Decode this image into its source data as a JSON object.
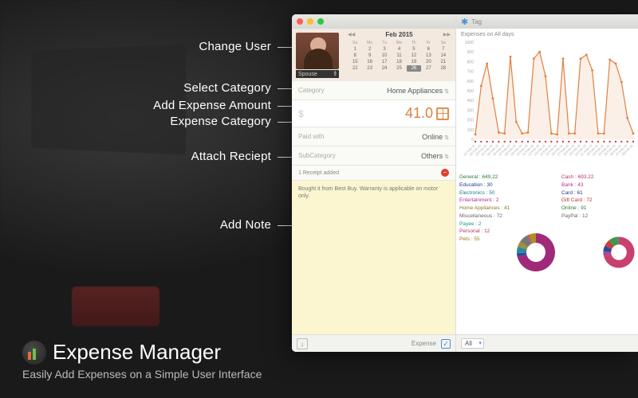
{
  "callouts": {
    "change_user": "Change User",
    "select_category": "Select Category",
    "add_amount": "Add Expense Amount",
    "expense_category": "Expense Category",
    "attach_receipt": "Attach Reciept",
    "add_note": "Add Note"
  },
  "app": {
    "title": "Expense Manager",
    "subtitle": "Easily Add Expenses on a Simple User Interface"
  },
  "user": {
    "name": "Spouse"
  },
  "calendar": {
    "title": "Feb 2015",
    "dow": [
      "Su",
      "Mo",
      "Tu",
      "We",
      "Th",
      "Fr",
      "Sa"
    ],
    "days": [
      "1",
      "2",
      "3",
      "4",
      "5",
      "6",
      "7",
      "8",
      "9",
      "10",
      "11",
      "12",
      "13",
      "14",
      "15",
      "16",
      "17",
      "18",
      "19",
      "20",
      "21",
      "22",
      "23",
      "24",
      "25",
      "26",
      "27",
      "28"
    ],
    "selected": "26"
  },
  "form": {
    "category_label": "Category",
    "category_value": "Home Appliances",
    "currency": "$",
    "amount": "41.0",
    "paid_label": "Paid with",
    "paid_value": "Online",
    "subcat_label": "SubCategory",
    "subcat_value": "Others",
    "receipt_text": "1 Receipt added",
    "note_text": "Bought it from Best Buy. Warranty is applicable on motor only.",
    "expense_label": "Expense"
  },
  "tag_label": "Tag",
  "chart_title": "Expenses on All days",
  "filter": "All",
  "stats_left": [
    {
      "label": "General",
      "value": "649.22",
      "color": "#2a7a3a"
    },
    {
      "label": "Education",
      "value": "30",
      "color": "#1a3a8a"
    },
    {
      "label": "Electronics",
      "value": "50",
      "color": "#1a7a9a"
    },
    {
      "label": "Entertainment",
      "value": "2",
      "color": "#b0309a"
    },
    {
      "label": "Home Appliances",
      "value": "41",
      "color": "#8a7a2a"
    },
    {
      "label": "Miscellaneous",
      "value": "72",
      "color": "#666"
    },
    {
      "label": "Payee",
      "value": "2",
      "color": "#1a9a7a"
    },
    {
      "label": "Personal",
      "value": "12",
      "color": "#c0306a"
    },
    {
      "label": "Pets",
      "value": "55",
      "color": "#9a7a1a"
    }
  ],
  "stats_right": [
    {
      "label": "Cash",
      "value": "693.22",
      "color": "#c0306a"
    },
    {
      "label": "Bank",
      "value": "43",
      "color": "#b0309a"
    },
    {
      "label": "Card",
      "value": "61",
      "color": "#1a3a8a"
    },
    {
      "label": "Gift Card",
      "value": "72",
      "color": "#c03030"
    },
    {
      "label": "Online",
      "value": "91",
      "color": "#2a7a3a"
    },
    {
      "label": "PayPal",
      "value": "12",
      "color": "#666"
    }
  ],
  "chart_data": {
    "type": "line",
    "title": "Expenses on All days",
    "xlabel": "",
    "ylabel": "",
    "ylim": [
      0,
      1000
    ],
    "yticks": [
      0,
      100,
      200,
      300,
      400,
      500,
      600,
      700,
      800,
      900,
      1000
    ],
    "categories": [
      "01-Feb-15",
      "02-Feb-15",
      "03-Feb-15",
      "04-Feb-15",
      "05-Feb-15",
      "06-Feb-15",
      "07-Feb-15",
      "08-Feb-15",
      "09-Feb-15",
      "10-Feb-15",
      "11-Feb-15",
      "12-Feb-15",
      "13-Feb-15",
      "14-Feb-15",
      "15-Feb-15",
      "16-Feb-15",
      "17-Feb-15",
      "18-Feb-15",
      "19-Feb-15",
      "20-Feb-15",
      "21-Feb-15",
      "22-Feb-15",
      "23-Feb-15",
      "24-Feb-15",
      "25-Feb-15",
      "26-Feb-15",
      "27-Feb-15",
      "28-Feb-15"
    ],
    "series": [
      {
        "name": "Expenses",
        "values": [
          50,
          550,
          780,
          420,
          70,
          60,
          850,
          180,
          60,
          70,
          830,
          900,
          650,
          60,
          50,
          830,
          60,
          60,
          830,
          870,
          710,
          60,
          60,
          820,
          780,
          590,
          220,
          60
        ]
      }
    ],
    "color": "#e08040"
  },
  "donut_left": [
    {
      "v": 649.22,
      "c": "#a02a7a"
    },
    {
      "v": 30,
      "c": "#2a4a9a"
    },
    {
      "v": 50,
      "c": "#2a8a9a"
    },
    {
      "v": 2,
      "c": "#c040a0"
    },
    {
      "v": 41,
      "c": "#a09030"
    },
    {
      "v": 72,
      "c": "#777"
    },
    {
      "v": 2,
      "c": "#2aa080"
    },
    {
      "v": 12,
      "c": "#c84070"
    },
    {
      "v": 55,
      "c": "#b09020"
    }
  ],
  "donut_right": [
    {
      "v": 693.22,
      "c": "#c84070"
    },
    {
      "v": 43,
      "c": "#b040a0"
    },
    {
      "v": 61,
      "c": "#2a4a9a"
    },
    {
      "v": 72,
      "c": "#c84040"
    },
    {
      "v": 91,
      "c": "#3a9a4a"
    },
    {
      "v": 12,
      "c": "#777"
    }
  ]
}
